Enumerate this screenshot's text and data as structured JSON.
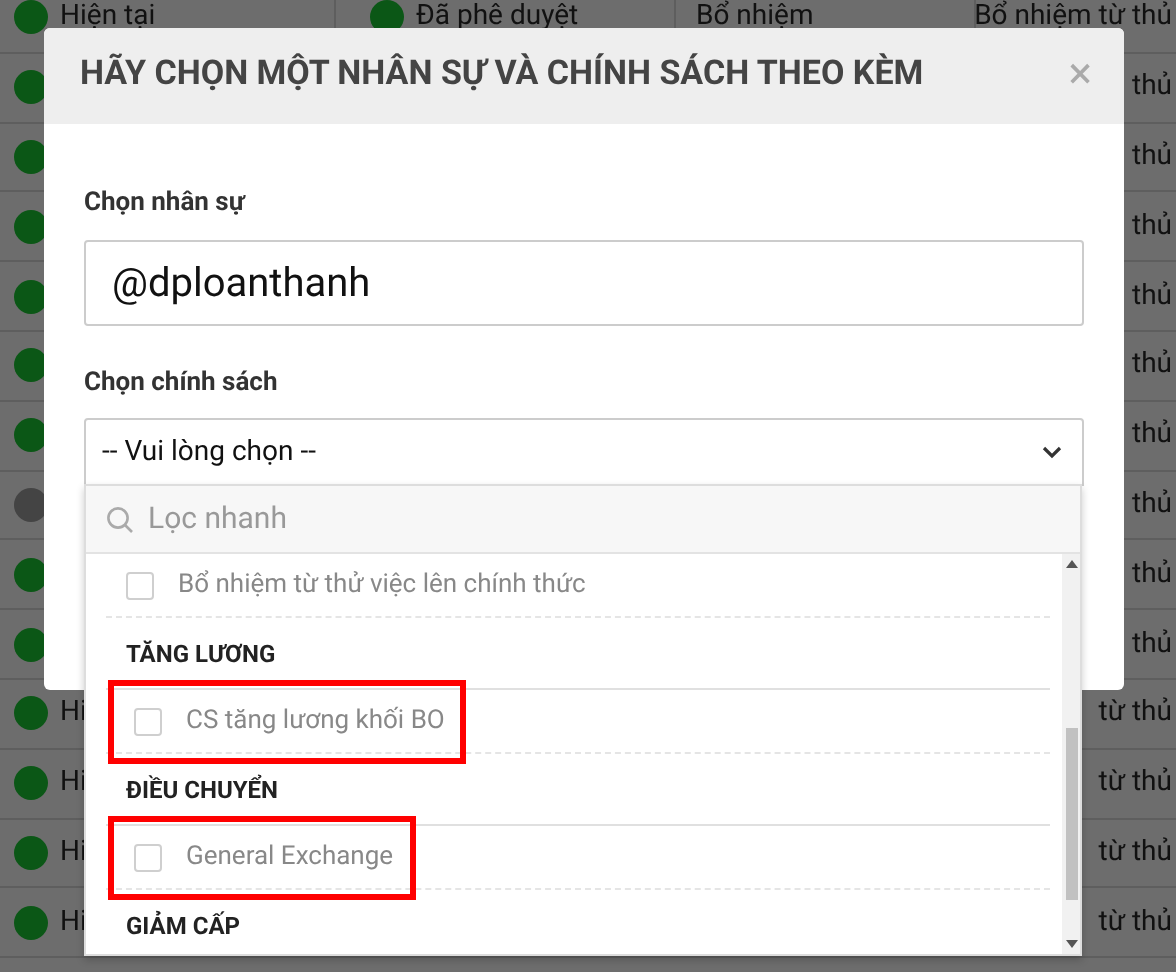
{
  "background_table": {
    "rows": [
      {
        "color": "#0b5716",
        "column_1": "Hiện tại",
        "column_2_dot": true,
        "column_2": "Đã phê duyệt",
        "column_3": "Bổ nhiệm",
        "column_4": "Bổ nhiệm từ thủ"
      },
      {
        "color": "#0b5716",
        "column_4": "thủ"
      },
      {
        "color": "#0b5716",
        "column_4": "thủ"
      },
      {
        "color": "#0b5716",
        "column_4": "thủ"
      },
      {
        "color": "#0b5716",
        "column_4": "thủ"
      },
      {
        "color": "#0b5716",
        "column_4": "thủ"
      },
      {
        "color": "#0b5716",
        "column_4": "thủ"
      },
      {
        "color": "#444444",
        "column_4": "thủ"
      },
      {
        "color": "#0b5716",
        "column_4": "thủ"
      },
      {
        "color": "#0b5716",
        "column_4": "thủ"
      },
      {
        "color": "#0b5716",
        "column_1": "Hi",
        "column_4": "từ thủ"
      },
      {
        "color": "#0b5716",
        "column_1": "Hi",
        "column_4": "từ thủ"
      },
      {
        "color": "#0b5716",
        "column_1": "Hi",
        "column_4": "từ thủ"
      },
      {
        "color": "#0b5716",
        "column_1": "Hi",
        "column_4": "từ thủ"
      }
    ]
  },
  "dialog": {
    "title": "HÃY CHỌN MỘT NHÂN SỰ VÀ CHÍNH SÁCH THEO KÈM",
    "close": "×",
    "employee_field": {
      "label": "Chọn nhân sự",
      "value": "@dploanthanh"
    },
    "policy_field": {
      "label": "Chọn chính sách",
      "value": "-- Vui lòng chọn --",
      "expanded": true,
      "search": {
        "placeholder": "Lọc nhanh"
      },
      "items": [
        {
          "kind": "option",
          "label": "Bổ nhiệm từ thử việc lên chính thức",
          "checked": false,
          "highlighted": false
        },
        {
          "kind": "group",
          "label": "TĂNG LƯƠNG"
        },
        {
          "kind": "option",
          "label": "CS tăng lương khối BO",
          "checked": false,
          "highlighted": true
        },
        {
          "kind": "group",
          "label": "ĐIỀU CHUYỂN"
        },
        {
          "kind": "option",
          "label": "General Exchange",
          "checked": false,
          "highlighted": true
        },
        {
          "kind": "group",
          "label": "GIẢM CẤP"
        }
      ]
    }
  }
}
